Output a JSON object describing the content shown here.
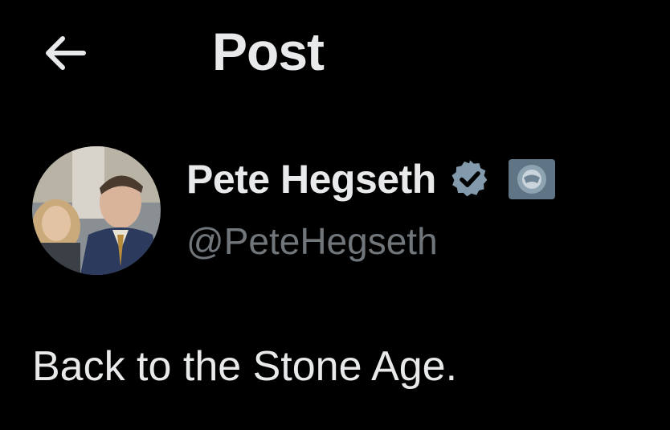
{
  "header": {
    "back_icon": "arrow-left-icon",
    "title": "Post"
  },
  "author": {
    "display_name": "Pete Hegseth",
    "handle": "@PeteHegseth",
    "verified_icon": "verified-badge-icon",
    "verified_color": "#829aab",
    "affiliation_icon": "affiliation-badge-icon"
  },
  "post": {
    "text": "Back to the Stone Age."
  },
  "colors": {
    "background": "#000000",
    "primary_text": "#e7e9ea",
    "secondary_text": "#71767b"
  }
}
